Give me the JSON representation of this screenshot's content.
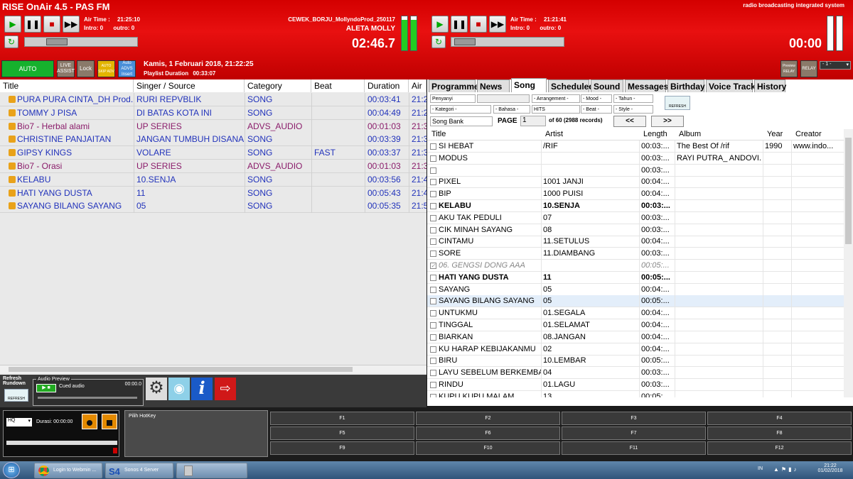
{
  "app": {
    "title": "RISE OnAir 4.5 - PAS FM",
    "subtitle": "radio broadcasting integrated system"
  },
  "player1": {
    "air_time_label": "Air Time :",
    "air_time": "21:25:10",
    "intro_label": "Intro:",
    "intro": "0",
    "outro_label": "outro:",
    "outro": "0"
  },
  "nowplaying": {
    "file": "CEWEK_BORJU_MollyndoProd_250117",
    "artist": "ALETA MOLLY",
    "time": "02:46.7"
  },
  "player2": {
    "air_time_label": "Air Time :",
    "air_time": "21:21:41",
    "intro_label": "Intro:",
    "intro": "0",
    "outro_label": "outro:",
    "outro": "0",
    "time": "00:00"
  },
  "modes": {
    "auto": "AUTO",
    "live": "LIVE ASSIST",
    "lock": "Lock",
    "auto_skip": "AUTO SKIP ADV",
    "auto_adv": "Auto ADVS Insert",
    "preview_relay": "Preview RELAY",
    "relay": "RELAY",
    "channel": "- 1 -"
  },
  "date": {
    "datetime": "Kamis, 1 Februari 2018, 21:22:25",
    "duration_label": "Playlist Duration",
    "duration": "00:33:07"
  },
  "playlist": {
    "headers": [
      "Title",
      "Singer / Source",
      "Category",
      "Beat",
      "Duration",
      "Air T"
    ],
    "rows": [
      {
        "title": "PURA PURA CINTA_DH Prod...",
        "singer": "RURI REPVBLIK",
        "cat": "SONG",
        "beat": "",
        "dur": "00:03:41",
        "air": "21:2",
        "color": "#2233bb"
      },
      {
        "title": "TOMMY J PISA",
        "singer": "DI BATAS KOTA INI",
        "cat": "SONG",
        "beat": "",
        "dur": "00:04:49",
        "air": "21:2",
        "color": "#2233bb"
      },
      {
        "title": "Bio7 - Herbal alami",
        "singer": "UP SERIES",
        "cat": "ADVS_AUDIO",
        "beat": "",
        "dur": "00:01:03",
        "air": "21:3",
        "color": "#8a1b6a"
      },
      {
        "title": "CHRISTINE PANJAITAN",
        "singer": "JANGAN TUMBUH DISANA",
        "cat": "SONG",
        "beat": "",
        "dur": "00:03:39",
        "air": "21:3",
        "color": "#2233bb"
      },
      {
        "title": "GIPSY KINGS",
        "singer": "VOLARE",
        "cat": "SONG",
        "beat": "FAST",
        "dur": "00:03:37",
        "air": "21:3",
        "color": "#2233bb"
      },
      {
        "title": "Bio7 - Orasi",
        "singer": "UP SERIES",
        "cat": "ADVS_AUDIO",
        "beat": "",
        "dur": "00:01:03",
        "air": "21:3",
        "color": "#8a1b6a"
      },
      {
        "title": "KELABU",
        "singer": "10.SENJA",
        "cat": "SONG",
        "beat": "",
        "dur": "00:03:56",
        "air": "21:4",
        "color": "#2233bb"
      },
      {
        "title": "HATI YANG DUSTA",
        "singer": "11",
        "cat": "SONG",
        "beat": "",
        "dur": "00:05:43",
        "air": "21:4",
        "color": "#2233bb"
      },
      {
        "title": "SAYANG BILANG SAYANG",
        "singer": "05",
        "cat": "SONG",
        "beat": "",
        "dur": "00:05:35",
        "air": "21:5",
        "color": "#2233bb"
      }
    ]
  },
  "tabs": [
    "Programme",
    "News",
    "Song",
    "Scheduled",
    "Sound",
    "Messages",
    "Birthday",
    "Voice Track",
    "History"
  ],
  "filters": {
    "penyanyi": "Penyanyi",
    "arrangement": "- Arrangement -",
    "mood": "- Mood -",
    "tahun": "- Tahun -",
    "kategori": "- Kategori -",
    "bahasa": "- Bahasa -",
    "hits": "HITS",
    "beat": "- Beat -",
    "style": "- Style -",
    "refresh": "REFRESH",
    "songbank": "Song Bank",
    "page_label": "PAGE",
    "page": "1",
    "records": "of 60 (2988 records)",
    "prev": "<<",
    "next": ">>"
  },
  "songs": {
    "headers": [
      "Title",
      "Artist",
      "Length",
      "Album",
      "Year",
      "Creator"
    ],
    "rows": [
      {
        "title": "SI HEBAT",
        "artist": "/RIF",
        "len": "00:03:...",
        "album": "The Best Of /rif",
        "year": "1990",
        "creator": "www.indo...",
        "style": ""
      },
      {
        "title": "MODUS",
        "artist": "",
        "len": "00:03:...",
        "album": "RAYI PUTRA_ ANDOVI...",
        "year": "",
        "creator": "",
        "style": ""
      },
      {
        "title": "",
        "artist": "",
        "len": "00:03:...",
        "album": "",
        "year": "",
        "creator": "",
        "style": ""
      },
      {
        "title": "PIXEL",
        "artist": "1001 JANJI",
        "len": "00:04:...",
        "album": "",
        "year": "",
        "creator": "",
        "style": ""
      },
      {
        "title": "BIP",
        "artist": "1000 PUISI",
        "len": "00:04:...",
        "album": "",
        "year": "",
        "creator": "",
        "style": ""
      },
      {
        "title": "KELABU",
        "artist": "10.SENJA",
        "len": "00:03:...",
        "album": "",
        "year": "",
        "creator": "",
        "style": "bold"
      },
      {
        "title": "AKU TAK PEDULI",
        "artist": "07",
        "len": "00:03:...",
        "album": "",
        "year": "",
        "creator": "",
        "style": ""
      },
      {
        "title": "CIK MINAH SAYANG",
        "artist": "08",
        "len": "00:03:...",
        "album": "",
        "year": "",
        "creator": "",
        "style": ""
      },
      {
        "title": "CINTAMU",
        "artist": "11.SETULUS",
        "len": "00:04:...",
        "album": "",
        "year": "",
        "creator": "",
        "style": ""
      },
      {
        "title": "SORE",
        "artist": "11.DIAMBANG",
        "len": "00:03:...",
        "album": "",
        "year": "",
        "creator": "",
        "style": ""
      },
      {
        "title": "06. GENGSI DONG AAA",
        "artist": "",
        "len": "00:05:...",
        "album": "",
        "year": "",
        "creator": "",
        "style": "italic"
      },
      {
        "title": "HATI YANG DUSTA",
        "artist": "11",
        "len": "00:05:...",
        "album": "",
        "year": "",
        "creator": "",
        "style": "bold"
      },
      {
        "title": "SAYANG",
        "artist": "05",
        "len": "00:04:...",
        "album": "",
        "year": "",
        "creator": "",
        "style": ""
      },
      {
        "title": "SAYANG BILANG SAYANG",
        "artist": "05",
        "len": "00:05:...",
        "album": "",
        "year": "",
        "creator": "",
        "style": "selected"
      },
      {
        "title": "UNTUKMU",
        "artist": "01.SEGALA",
        "len": "00:04:...",
        "album": "",
        "year": "",
        "creator": "",
        "style": ""
      },
      {
        "title": "TINGGAL",
        "artist": "01.SELAMAT",
        "len": "00:04:...",
        "album": "",
        "year": "",
        "creator": "",
        "style": ""
      },
      {
        "title": "BIARKAN",
        "artist": "08.JANGAN",
        "len": "00:04:...",
        "album": "",
        "year": "",
        "creator": "",
        "style": ""
      },
      {
        "title": "KU HARAP KEBIJAKANMU",
        "artist": "02",
        "len": "00:04:...",
        "album": "",
        "year": "",
        "creator": "",
        "style": ""
      },
      {
        "title": "BIRU",
        "artist": "10.LEMBAR",
        "len": "00:05:...",
        "album": "",
        "year": "",
        "creator": "",
        "style": ""
      },
      {
        "title": "LAYU SEBELUM BERKEMBA...",
        "artist": "04",
        "len": "00:03:...",
        "album": "",
        "year": "",
        "creator": "",
        "style": ""
      },
      {
        "title": "RINDU",
        "artist": "01.LAGU",
        "len": "00:03:...",
        "album": "",
        "year": "",
        "creator": "",
        "style": ""
      },
      {
        "title": "KUPU KUPU MALAM",
        "artist": "13",
        "len": "00:05:...",
        "album": "",
        "year": "",
        "creator": "",
        "style": ""
      }
    ]
  },
  "bottom": {
    "refresh_rundown": "Refresh Rundown",
    "refresh": "REFRESH",
    "audio_preview": "Audio Preview",
    "cued_audio": "Cued audio",
    "cued_time": "00:00.0",
    "quality": "HQ",
    "durasi_label": "Durasi:",
    "durasi": "00:00:00",
    "pilih_hotkey": "Pilih HotKey"
  },
  "fkeys": [
    "F1",
    "F2",
    "F3",
    "F4",
    "F5",
    "F6",
    "F7",
    "F8",
    "F9",
    "F10",
    "F11",
    "F12"
  ],
  "taskbar": {
    "chrome": "Login to Webmin ...",
    "sonos": "Sonos 4 Server",
    "lang": "IN",
    "time": "21:22",
    "date": "01/02/2018"
  },
  "colors": {
    "red": "#d40000",
    "song_blue": "#2233bb",
    "advs_purple": "#8a1b6a"
  }
}
